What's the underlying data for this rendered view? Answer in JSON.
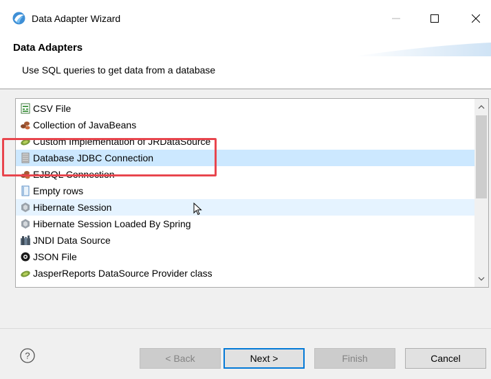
{
  "window": {
    "title": "Data Adapter Wizard",
    "minimize_glyph": "—",
    "maximize_glyph": "☐",
    "close_glyph": "✕"
  },
  "banner": {
    "title": "Data Adapters",
    "description": "Use SQL queries to get data from a database"
  },
  "adapters": {
    "items": [
      {
        "label": "CSV File",
        "icon": "csv-file-icon"
      },
      {
        "label": "Collection of JavaBeans",
        "icon": "beans-icon"
      },
      {
        "label": "Custom Implementation of JRDataSource",
        "icon": "custom-source-icon"
      },
      {
        "label": "Database JDBC Connection",
        "icon": "database-icon",
        "state": "selected"
      },
      {
        "label": "EJBQL Connection",
        "icon": "beans-icon"
      },
      {
        "label": "Empty rows",
        "icon": "empty-rows-icon"
      },
      {
        "label": "Hibernate Session",
        "icon": "hibernate-icon",
        "state": "hover"
      },
      {
        "label": "Hibernate Session Loaded By Spring",
        "icon": "hibernate-icon"
      },
      {
        "label": "JNDI Data Source",
        "icon": "jndi-icon"
      },
      {
        "label": "JSON File",
        "icon": "json-icon"
      },
      {
        "label": "JasperReports DataSource Provider class",
        "icon": "custom-source-icon"
      }
    ]
  },
  "buttons": {
    "back": "< Back",
    "next": "Next >",
    "finish": "Finish",
    "cancel": "Cancel",
    "help": "?"
  },
  "colors": {
    "selection": "#cce8ff",
    "hover": "#e5f3ff",
    "highlight_box": "#e8454d",
    "default_button_border": "#0078d7"
  }
}
